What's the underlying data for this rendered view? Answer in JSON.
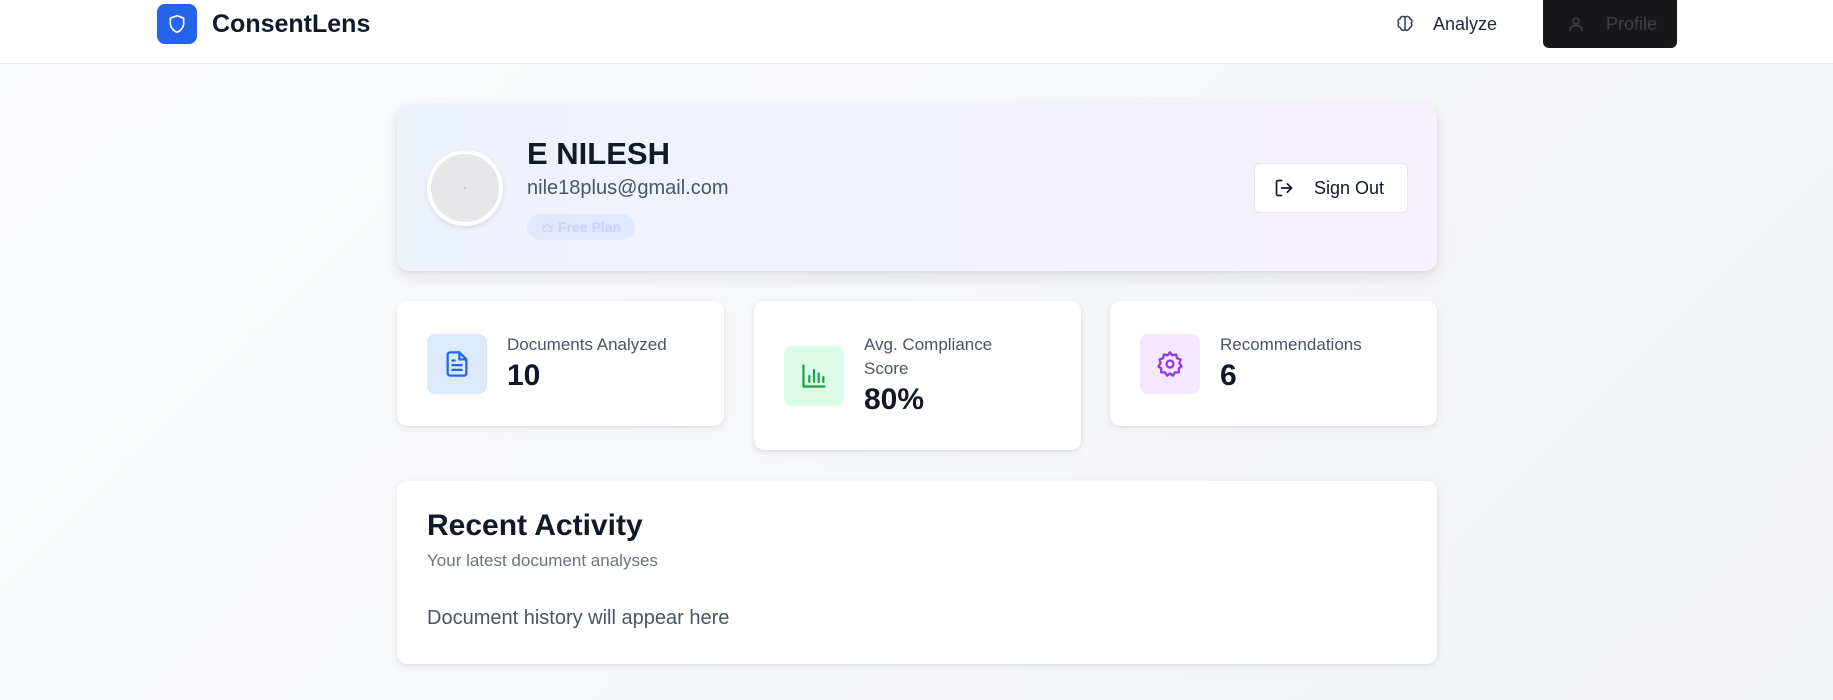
{
  "header": {
    "brand_name": "ConsentLens",
    "brand_icon": "shield-icon",
    "nav": {
      "analyze_label": "Analyze",
      "analyze_icon": "brain-icon",
      "profile_label": "Profile",
      "profile_icon": "user-icon"
    }
  },
  "profile": {
    "name": "E NILESH",
    "email": "nile18plus@gmail.com",
    "plan": "Free Plan",
    "plan_icon": "crown-icon",
    "sign_out_label": "Sign Out",
    "sign_out_icon": "log-out-icon"
  },
  "stats": [
    {
      "label": "Documents Analyzed",
      "value": "10",
      "icon": "file-text-icon",
      "accent": "#2563eb",
      "icon_bg": "#dbeafe"
    },
    {
      "label": "Avg. Compliance Score",
      "value": "80%",
      "icon": "bar-chart-icon",
      "accent": "#16a34a",
      "icon_bg": "#dcfce7"
    },
    {
      "label": "Recommendations",
      "value": "6",
      "icon": "settings-gear-icon",
      "accent": "#9333ea",
      "icon_bg": "#f3e8ff"
    }
  ],
  "recent_activity": {
    "title": "Recent Activity",
    "subtitle": "Your latest document analyses",
    "empty_text": "Document history will appear here"
  },
  "colors": {
    "brand": "#2563eb",
    "profile_button_bg": "#18181b"
  }
}
